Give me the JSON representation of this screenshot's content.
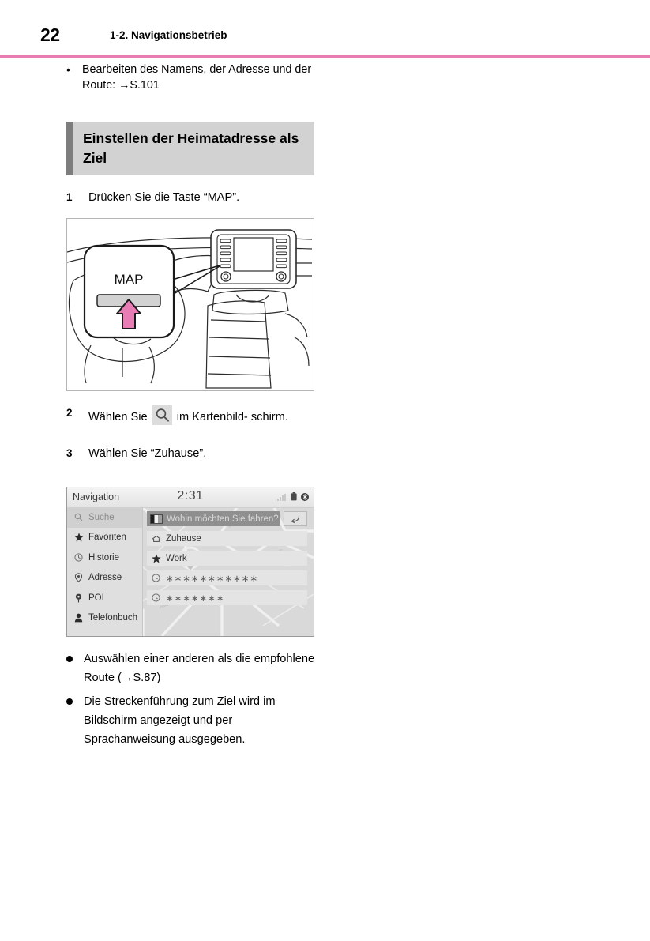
{
  "header": {
    "page_number": "22",
    "chapter_title": "1-2. Navigationsbetrieb",
    "rule_color": "#e87cb5"
  },
  "intro_bullets": [
    {
      "marker": "•",
      "text": "Bearbeiten des Namens, der Adresse und der Route: →S.101"
    }
  ],
  "section": {
    "heading": "Einstellen der Heimatadresse als Ziel",
    "accent_color": "#7d7d7d",
    "background_color": "#d2d2d2"
  },
  "steps": [
    {
      "number": "1",
      "text_before": "Drücken Sie die Taste “MAP”.",
      "icon": null,
      "text_after": ""
    },
    {
      "number": "2",
      "text_before": "Wählen Sie ",
      "icon": "search-icon",
      "text_after": " im Kartenbild-schirm."
    },
    {
      "number": "3",
      "text_before": "Wählen Sie “Zuhause”.",
      "icon": null,
      "text_after": ""
    }
  ],
  "step2_parts": {
    "lead": "Wählen Sie",
    "trail": "im Kartenbild-",
    "wrap": "schirm."
  },
  "dashboard_figure": {
    "callout_label": "MAP",
    "arrow_color": "#e87cb5",
    "button_color": "#d2d2d2",
    "description": "Armaturenbrett mit hervorgehobener MAP-Taste"
  },
  "nav_screen": {
    "title": "Navigation",
    "clock": "2:31",
    "status_icons": [
      "signal-icon",
      "battery-icon",
      "bluetooth-icon"
    ],
    "search_placeholder": "Wohin möchten Sie fahren?",
    "return_button_icon": "return-arrow-icon",
    "sidebar": [
      {
        "label": "Suche",
        "icon": "search-icon",
        "selected": true
      },
      {
        "label": "Favoriten",
        "icon": "star-icon",
        "selected": false
      },
      {
        "label": "Historie",
        "icon": "clock-icon",
        "selected": false
      },
      {
        "label": "Adresse",
        "icon": "map-pin-icon",
        "selected": false
      },
      {
        "label": "POI",
        "icon": "poi-pin-icon",
        "selected": false
      },
      {
        "label": "Telefonbuch",
        "icon": "person-icon",
        "selected": false
      }
    ],
    "results": [
      {
        "label": "Zuhause",
        "icon": "home-icon",
        "masked": false
      },
      {
        "label": "Work",
        "icon": "star-icon",
        "masked": false
      },
      {
        "label": "∗∗∗∗∗∗∗∗∗∗∗",
        "icon": "clock-icon",
        "masked": true
      },
      {
        "label": "∗∗∗∗∗∗∗",
        "icon": "clock-icon",
        "masked": true
      }
    ]
  },
  "closing_bullets": [
    {
      "text": "Auswählen einer anderen als die empfohlene Route (→S.87)"
    },
    {
      "text": "Die Streckenführung zum Ziel wird im Bildschirm angezeigt und per Sprachanweisung ausgegeben."
    }
  ]
}
